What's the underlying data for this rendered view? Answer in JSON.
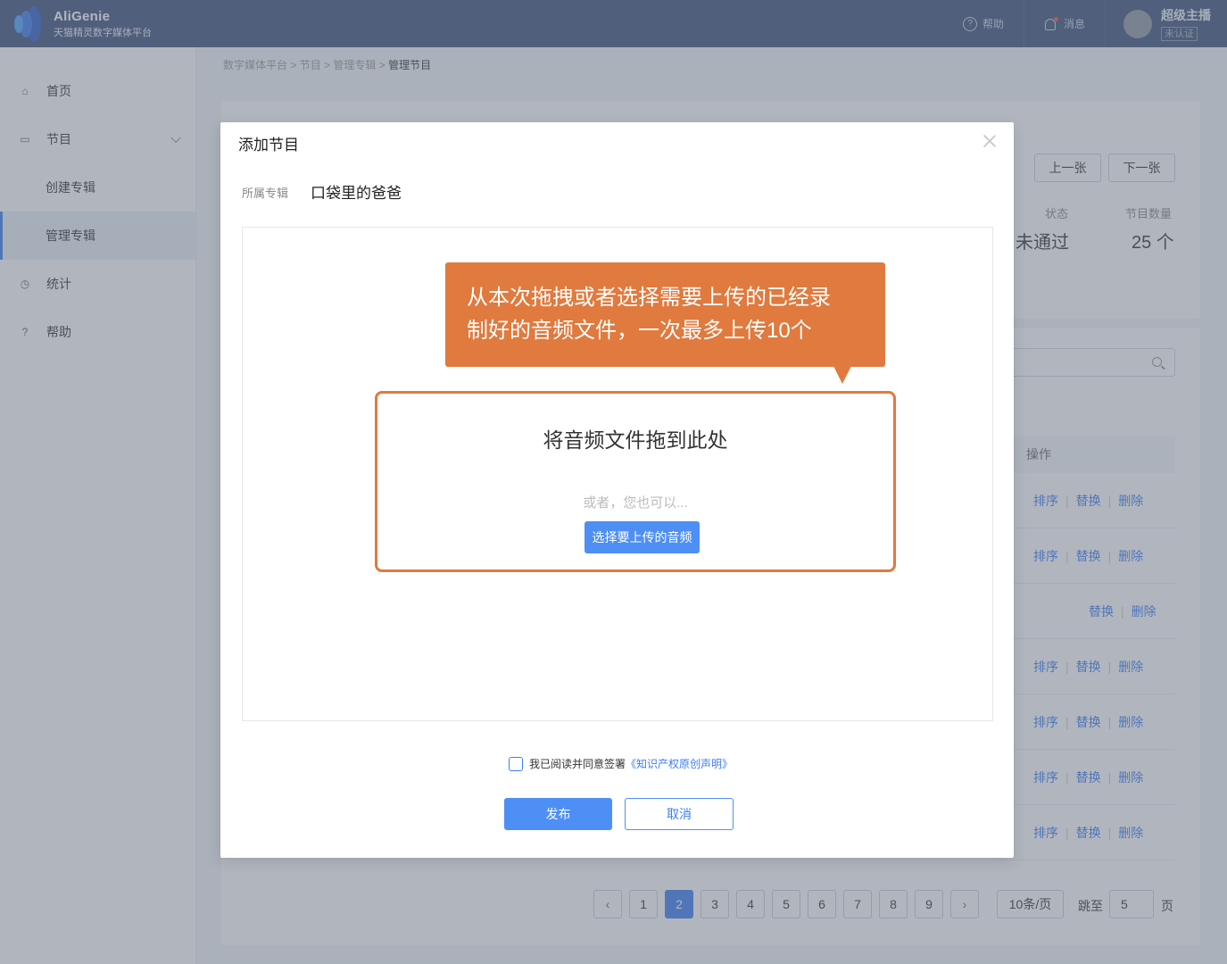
{
  "app": {
    "name": "AliGenie",
    "subtitle": "天猫精灵数字媒体平台"
  },
  "topbar": {
    "help": "帮助",
    "messages": "消息",
    "user_name": "超级主播",
    "user_badge": "未认证"
  },
  "sidebar": {
    "items": [
      {
        "label": "首页",
        "icon": "home-icon"
      },
      {
        "label": "节目",
        "icon": "video-icon"
      },
      {
        "label": "创建专辑"
      },
      {
        "label": "管理专辑"
      },
      {
        "label": "统计",
        "icon": "clock-icon"
      },
      {
        "label": "帮助",
        "icon": "help-icon"
      }
    ]
  },
  "breadcrumb": [
    "数字媒体平台",
    "节目",
    "管理专辑",
    "管理节目"
  ],
  "album_card": {
    "prev": "上一张",
    "next": "下一张",
    "status_label": "状态",
    "status_value": "未通过",
    "count_label": "节目数量",
    "count_value": "25 个"
  },
  "table": {
    "action_header": "操作",
    "actions": {
      "sort": "排序",
      "replace": "替换",
      "delete": "删除"
    }
  },
  "pagination": {
    "pages": [
      "1",
      "2",
      "3",
      "4",
      "5",
      "6",
      "7",
      "8",
      "9"
    ],
    "current": "2",
    "page_size": "10条/页",
    "jump_label": "跳至",
    "jump_value": "5",
    "page_unit": "页"
  },
  "dialog": {
    "title": "添加节目",
    "album_label": "所属专辑",
    "album_name": "口袋里的爸爸",
    "drop_title": "将音频文件拖到此处",
    "drop_or": "或者，您也可以...",
    "select_button": "选择要上传的音频",
    "agree_text": "我已阅读并同意签署",
    "agree_link": "《知识产权原创声明》",
    "publish": "发布",
    "cancel": "取消"
  },
  "tooltip": {
    "line1": "从本次拖拽或者选择需要上传的已经录",
    "line2": "制好的音频文件，一次最多上传10个"
  },
  "colors": {
    "header": "#3c5179",
    "accent": "#3c7df4",
    "highlight": "#e07a3e"
  }
}
